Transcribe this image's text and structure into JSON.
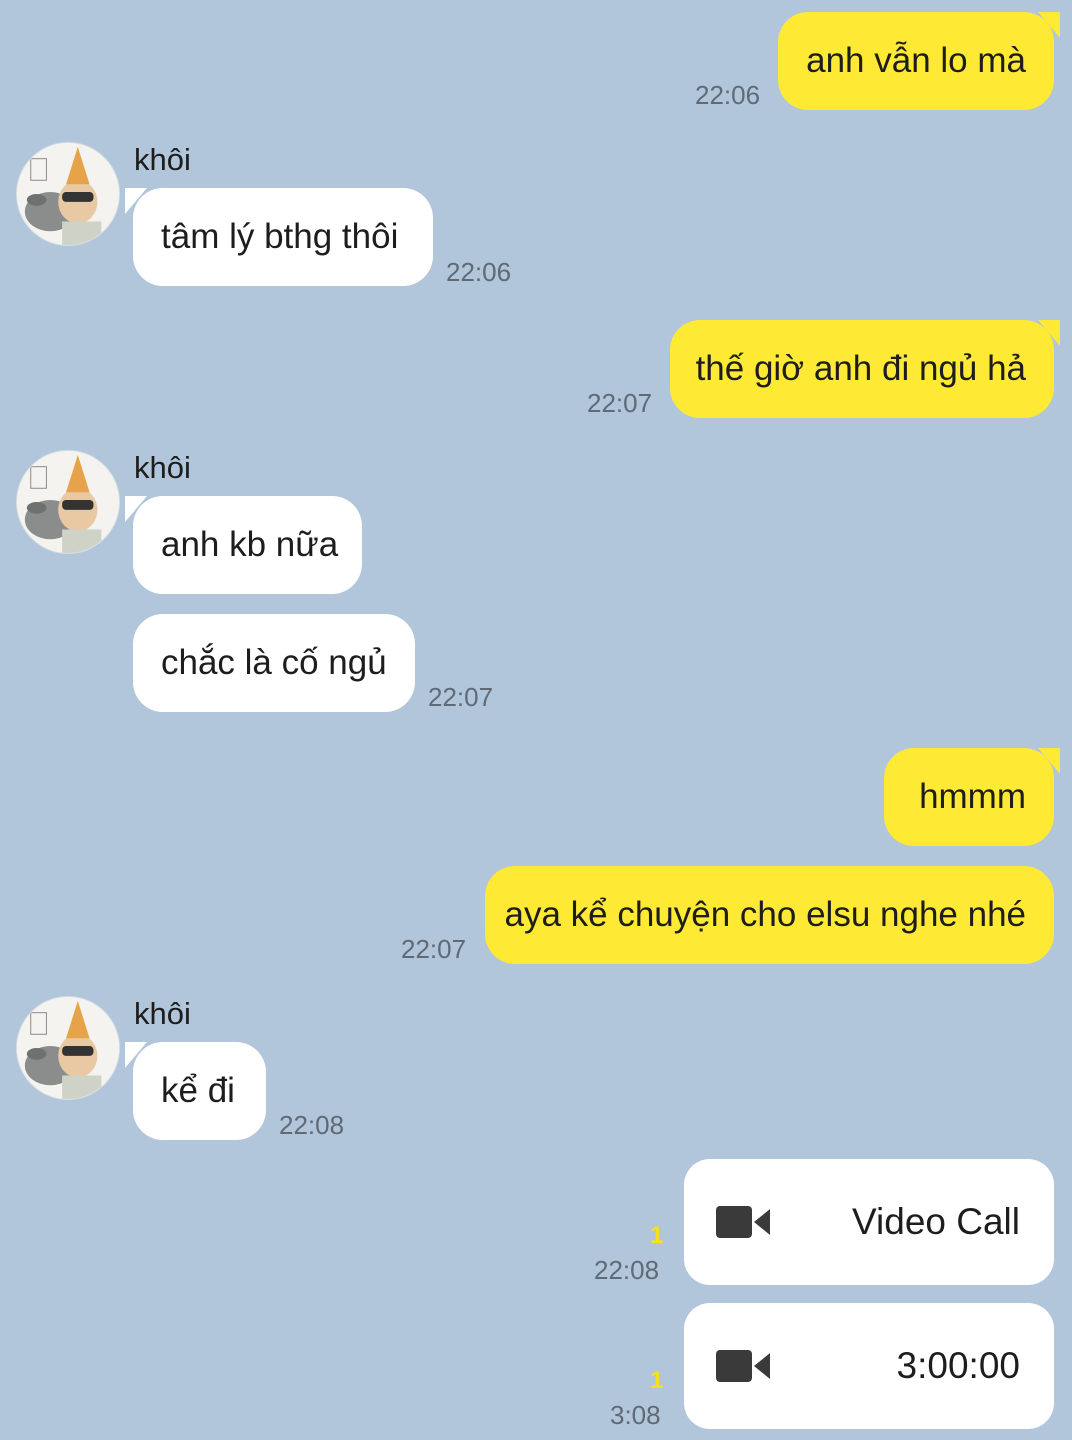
{
  "contact": {
    "name": "khôi"
  },
  "messages": {
    "m1": {
      "text": "anh vẫn lo mà",
      "time": "22:06"
    },
    "m2": {
      "sender": "khôi",
      "text": "tâm lý bthg thôi",
      "time": "22:06"
    },
    "m3": {
      "text": "thế giờ anh đi ngủ hả",
      "time": "22:07"
    },
    "m4": {
      "sender": "khôi",
      "text": "anh kb nữa"
    },
    "m5": {
      "text": "chắc là cố ngủ",
      "time": "22:07"
    },
    "m6": {
      "text": "hmmm"
    },
    "m7": {
      "text": "aya kể chuyện cho elsu nghe nhé",
      "time": "22:07"
    },
    "m8": {
      "sender": "khôi",
      "text": "kể đi",
      "time": "22:08"
    },
    "m9": {
      "label": "Video Call",
      "unread": "1",
      "time": "22:08",
      "icon": "video-camera-icon"
    },
    "m10": {
      "label": "3:00:00",
      "unread": "1",
      "time": "3:08",
      "icon": "video-camera-icon"
    }
  },
  "colors": {
    "background": "#b1c6da",
    "my_bubble": "#fee934",
    "their_bubble": "#ffffff",
    "unread": "#f7e11b"
  }
}
